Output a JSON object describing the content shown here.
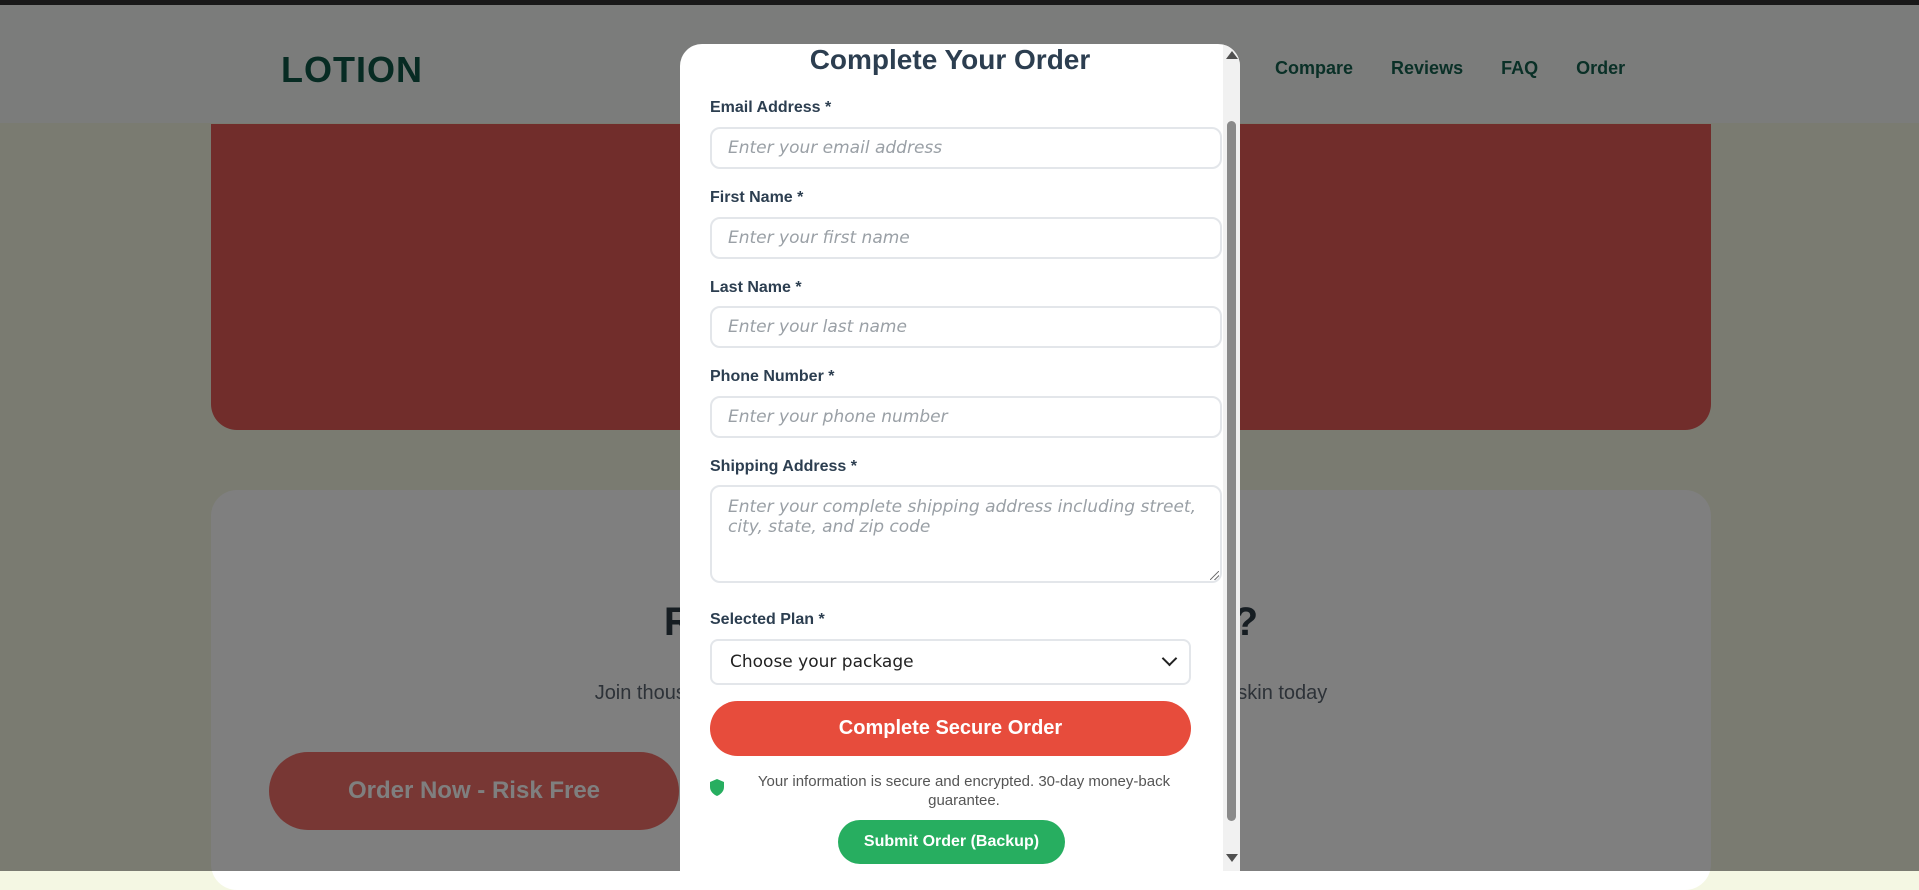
{
  "background": {
    "logo": "LOTION",
    "nav": [
      "Compare",
      "Reviews",
      "FAQ",
      "Order"
    ],
    "cta_title": "Ready to Transform Your Skin?",
    "cta_sub": "Join thousands of satisfied customers and start your journey to healthier skin today",
    "cta_button": "Order Now - Risk Free"
  },
  "modal": {
    "title": "Complete Your Order",
    "email": {
      "label": "Email Address *",
      "placeholder": "Enter your email address"
    },
    "first_name": {
      "label": "First Name *",
      "placeholder": "Enter your first name"
    },
    "last_name": {
      "label": "Last Name *",
      "placeholder": "Enter your last name"
    },
    "phone": {
      "label": "Phone Number *",
      "placeholder": "Enter your phone number"
    },
    "address": {
      "label": "Shipping Address *",
      "placeholder": "Enter your complete shipping address including street, city, state, and zip code"
    },
    "plan": {
      "label": "Selected Plan *",
      "value": "Choose your package"
    },
    "submit": "Complete Secure Order",
    "security_note": "Your information is secure and encrypted. 30-day money-back guarantee.",
    "backup_submit": "Submit Order (Backup)"
  },
  "colors": {
    "primary_red": "#e74c3c",
    "success_green": "#27ae60",
    "heading": "#2c3e50"
  }
}
